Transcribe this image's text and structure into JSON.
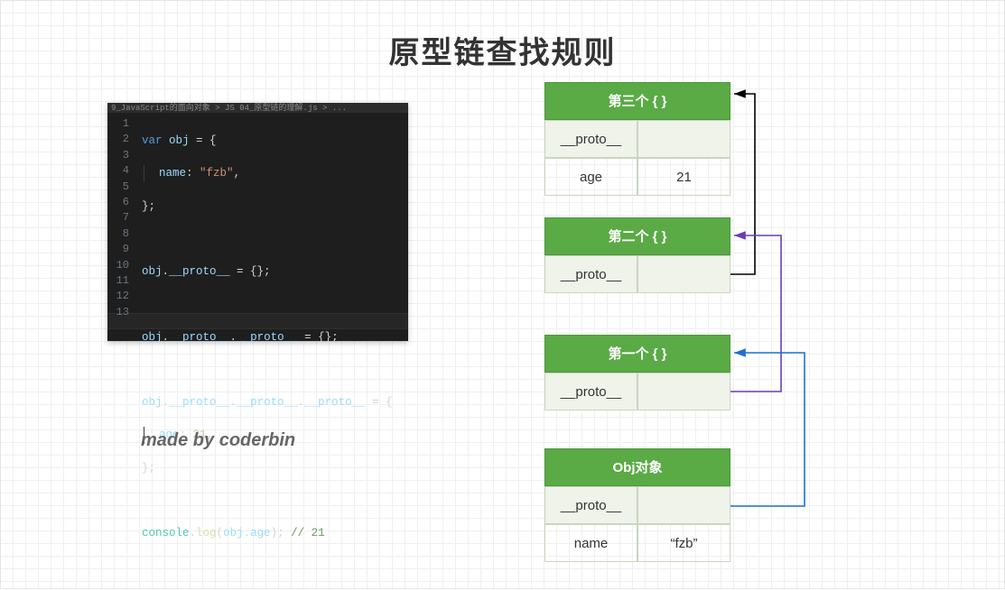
{
  "title": "原型链查找规则",
  "credit": "made by coderbin",
  "editor": {
    "tabbar": "9_JavaScript的面向对象 > JS 04_原型链的理解.js > ...",
    "lines": [
      "1",
      "2",
      "3",
      "4",
      "5",
      "6",
      "7",
      "8",
      "9",
      "10",
      "11",
      "12",
      "13"
    ],
    "code": {
      "l1_kw": "var",
      "l1_var": "obj",
      "l1_rest": " = {",
      "l2_prop": "name",
      "l2_val": "\"fzb\"",
      "l2_comma": ",",
      "l3": "};",
      "l5_a": "obj",
      "l5_b": "__proto__",
      "l5_rest": " = {};",
      "l7_a": "obj",
      "l7_b": "__proto__",
      "l7_c": "__proto__",
      "l7_rest": " = {};",
      "l9_a": "obj",
      "l9_b": "__proto__",
      "l9_c": "__proto__",
      "l9_d": "__proto__",
      "l9_rest": " = {",
      "l10_prop": "age",
      "l10_val": "21",
      "l10_comma": ",",
      "l11": "};",
      "l13_a": "console",
      "l13_b": "log",
      "l13_c": "obj",
      "l13_d": "age",
      "l13_close": ");",
      "l13_cmt": "// 21"
    }
  },
  "boxes": {
    "third": {
      "title": "第三个 { }",
      "rows": [
        {
          "k": "__proto__",
          "v": ""
        },
        {
          "k": "age",
          "v": "21"
        }
      ]
    },
    "second": {
      "title": "第二个 { }",
      "rows": [
        {
          "k": "__proto__",
          "v": ""
        }
      ]
    },
    "first": {
      "title": "第一个 { }",
      "rows": [
        {
          "k": "__proto__",
          "v": ""
        }
      ]
    },
    "obj": {
      "title": "Obj对象",
      "rows": [
        {
          "k": "__proto__",
          "v": ""
        },
        {
          "k": "name",
          "v": "“fzb”"
        }
      ]
    }
  }
}
